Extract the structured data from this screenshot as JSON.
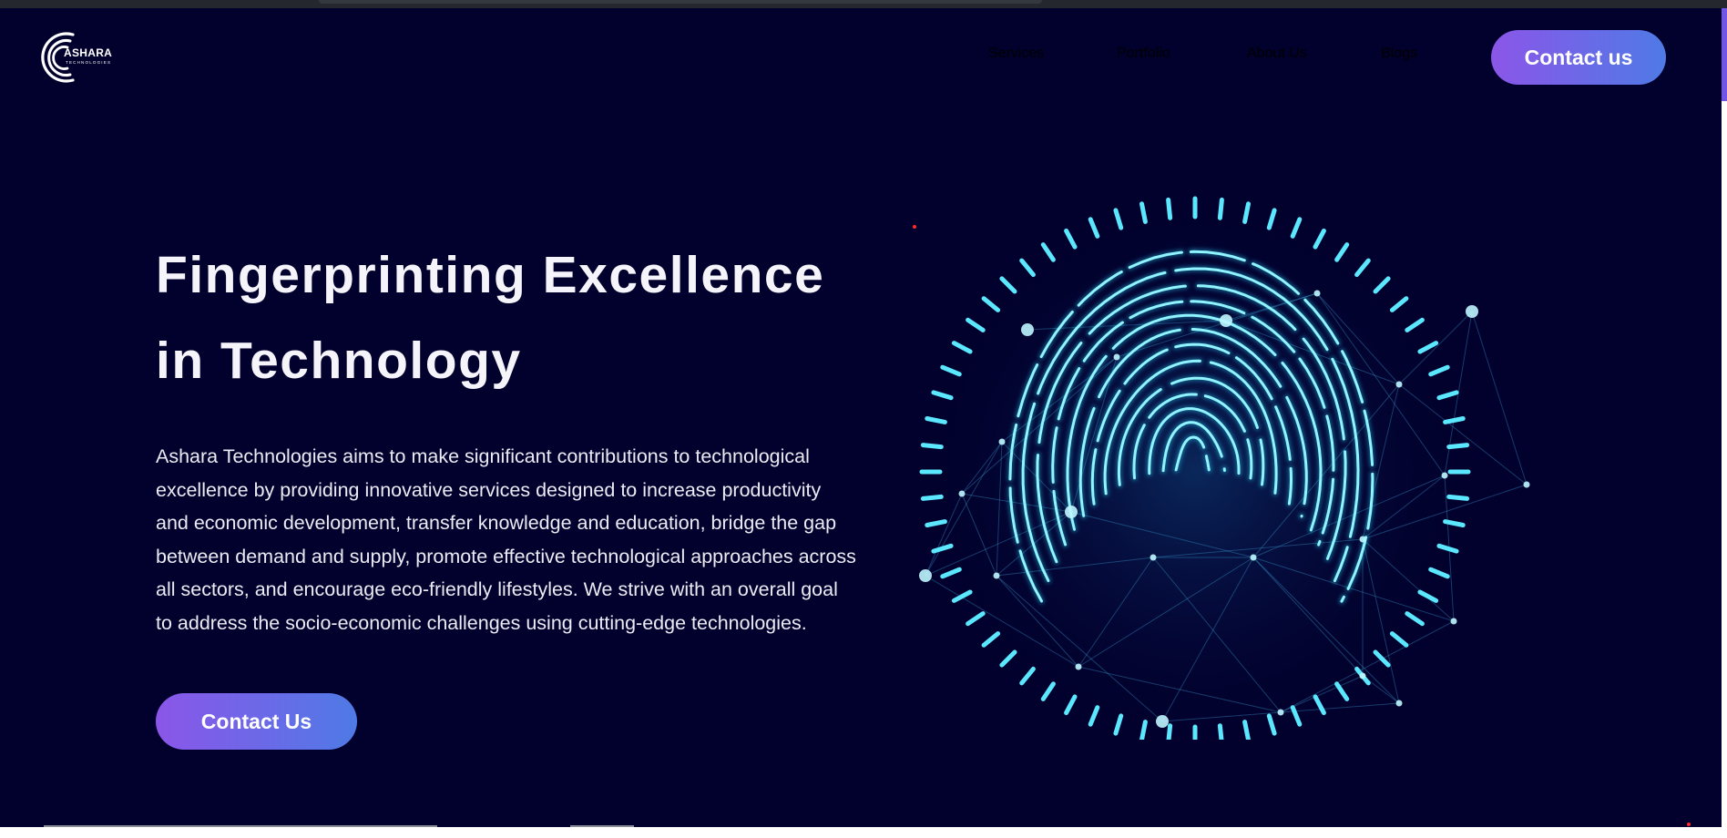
{
  "brand": {
    "name": "ASHARA",
    "tagline": "TECHNOLOGIES"
  },
  "nav": {
    "items": [
      {
        "label": "Services"
      },
      {
        "label": "Portfolio"
      },
      {
        "label": "About Us"
      },
      {
        "label": "Blogs"
      }
    ],
    "cta_label": "Contact us"
  },
  "hero": {
    "title_line1": "Fingerprinting Excellence",
    "title_line2": "in Technology",
    "description": "Ashara Technologies aims to make significant contributions to technological excellence by providing innovative services designed to increase productivity and economic development, transfer knowledge and education, bridge the gap between demand and supply, promote effective technological approaches across all sectors, and encourage eco-friendly lifestyles. We strive with an overall goal to address the socio-economic challenges using cutting-edge technologies.",
    "button_label": "Contact Us",
    "illustration_icon": "fingerprint-icon"
  },
  "colors": {
    "background": "#02012d",
    "accent_gradient_start": "#8b56e8",
    "accent_gradient_end": "#4f7ae6",
    "fingerprint_glow": "#3fe3ff"
  }
}
